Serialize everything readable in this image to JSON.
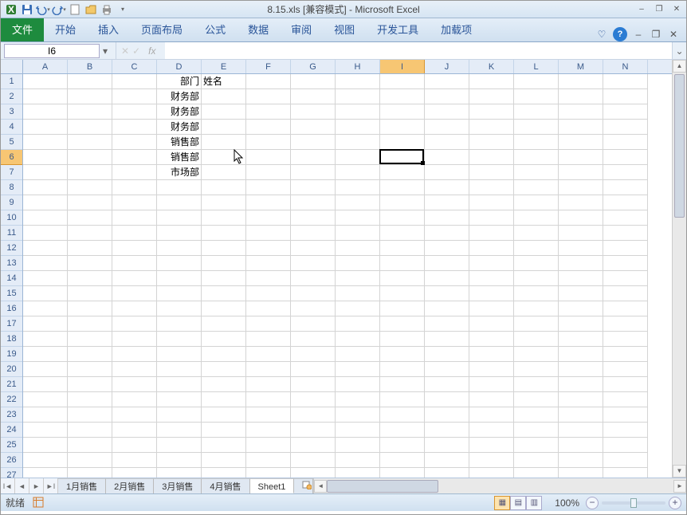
{
  "title": "8.15.xls [兼容模式] - Microsoft Excel",
  "qat": {
    "items": [
      "excel",
      "save",
      "undo",
      "redo",
      "new",
      "open",
      "print"
    ]
  },
  "window_controls": {
    "minimize": "–",
    "restore": "❐",
    "close": "✕"
  },
  "ribbon": {
    "file": "文件",
    "tabs": [
      "开始",
      "插入",
      "页面布局",
      "公式",
      "数据",
      "审阅",
      "视图",
      "开发工具",
      "加载项"
    ]
  },
  "namebox": {
    "value": "I6"
  },
  "formula": {
    "fx": "fx",
    "value": ""
  },
  "columns": [
    "A",
    "B",
    "C",
    "D",
    "E",
    "F",
    "G",
    "H",
    "I",
    "J",
    "K",
    "L",
    "M",
    "N"
  ],
  "rows": [
    "1",
    "2",
    "3",
    "4",
    "5",
    "6",
    "7",
    "8",
    "9",
    "10",
    "11",
    "12",
    "13",
    "14",
    "15",
    "16",
    "17",
    "18",
    "19",
    "20",
    "21",
    "22",
    "23",
    "24",
    "25",
    "26",
    "27"
  ],
  "active_col": "I",
  "active_row": "6",
  "cells": {
    "D1": "部门",
    "E1": "姓名",
    "D2": "财务部",
    "D3": "财务部",
    "D4": "财务部",
    "D5": "销售部",
    "D6": "销售部",
    "D7": "市场部"
  },
  "sheet_tabs": [
    "1月销售",
    "2月销售",
    "3月销售",
    "4月销售",
    "Sheet1"
  ],
  "active_sheet": "Sheet1",
  "status": {
    "ready": "就绪",
    "macro_icon": "▦"
  },
  "zoom": {
    "label": "100%",
    "minus": "−",
    "plus": "+"
  }
}
